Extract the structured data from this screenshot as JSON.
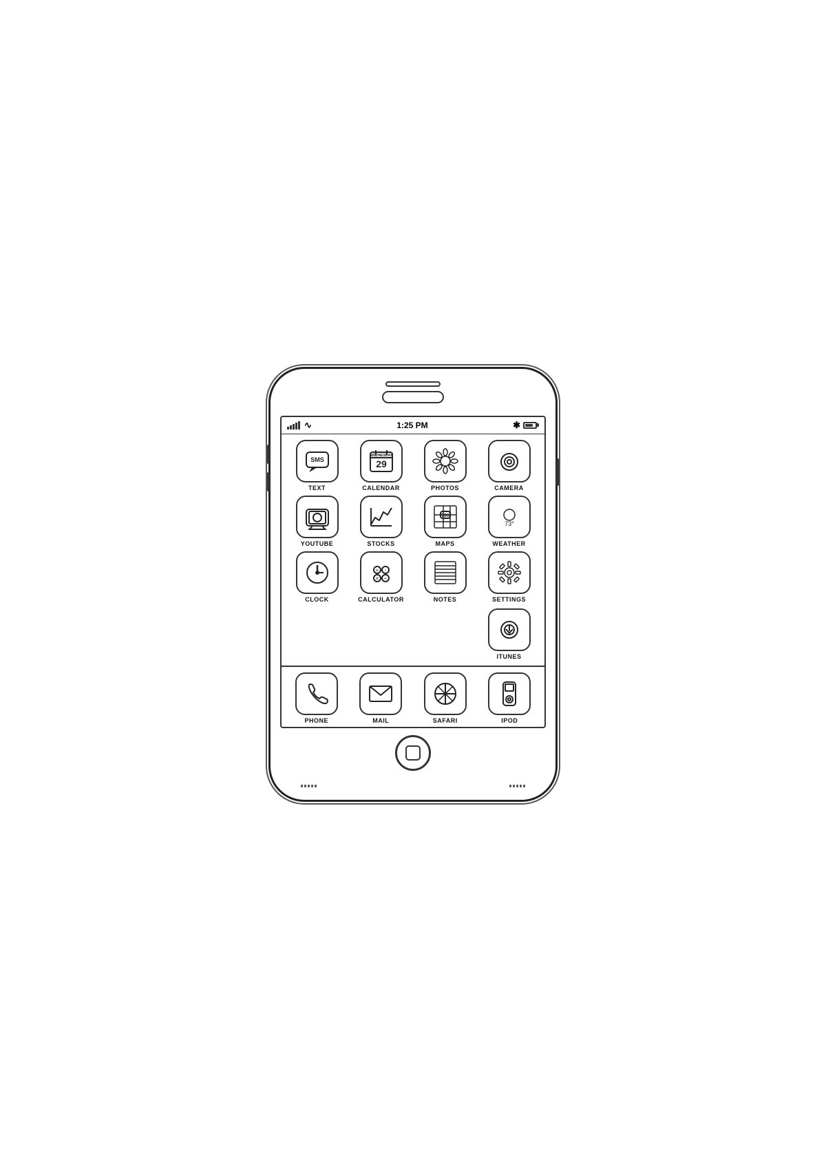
{
  "phone": {
    "status": {
      "time": "1:25 PM",
      "signal_bars": [
        4,
        6,
        8,
        10,
        12
      ],
      "bluetooth": "✱",
      "battery_label": "battery"
    },
    "apps": [
      {
        "id": "text",
        "label": "TEXT",
        "icon": "sms"
      },
      {
        "id": "calendar",
        "label": "CALENDAR",
        "icon": "calendar"
      },
      {
        "id": "photos",
        "label": "PHOTOS",
        "icon": "photos"
      },
      {
        "id": "camera",
        "label": "CAMERA",
        "icon": "camera"
      },
      {
        "id": "youtube",
        "label": "YOUTUBE",
        "icon": "youtube"
      },
      {
        "id": "stocks",
        "label": "STOCKS",
        "icon": "stocks"
      },
      {
        "id": "maps",
        "label": "MAPS",
        "icon": "maps"
      },
      {
        "id": "weather",
        "label": "WEATHER",
        "icon": "weather"
      },
      {
        "id": "clock",
        "label": "CLOCK",
        "icon": "clock"
      },
      {
        "id": "calculator",
        "label": "CALCULATOR",
        "icon": "calculator"
      },
      {
        "id": "notes",
        "label": "NOTES",
        "icon": "notes"
      },
      {
        "id": "settings",
        "label": "SETTINGS",
        "icon": "settings"
      },
      {
        "id": "itunes",
        "label": "ITUNES",
        "icon": "itunes"
      }
    ],
    "dock": [
      {
        "id": "phone",
        "label": "PHONE",
        "icon": "phone"
      },
      {
        "id": "mail",
        "label": "MAIL",
        "icon": "mail"
      },
      {
        "id": "safari",
        "label": "SAFARI",
        "icon": "safari"
      },
      {
        "id": "ipod",
        "label": "IPOD",
        "icon": "ipod"
      }
    ],
    "calendar_day": "29",
    "calendar_weekday": "WEDNESDAY",
    "weather_temp": "73°"
  }
}
